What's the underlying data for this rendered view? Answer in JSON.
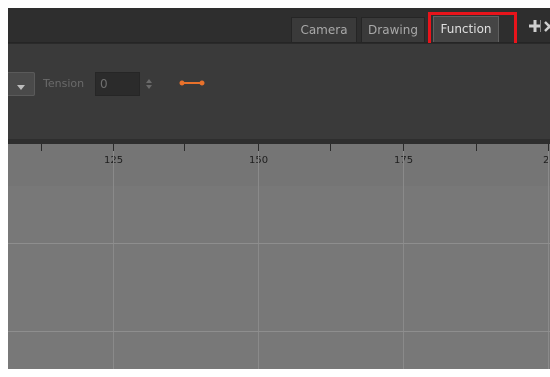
{
  "tabs": {
    "camera": "Camera",
    "drawing": "Drawing",
    "function": "Function"
  },
  "tab_actions": {
    "add_icon": "plus-icon",
    "close_icon": "close-icon"
  },
  "toolbar": {
    "tension_label": "Tension",
    "tension_value": "0",
    "stepper_icon": "stepper-arrows-icon",
    "link_icon": "orange-line-with-points-icon"
  },
  "graph": {
    "ruler_labels": [
      "125",
      "150",
      "175",
      "2"
    ]
  },
  "colors": {
    "highlight": "#e8141b",
    "accent": "#e8712b"
  }
}
